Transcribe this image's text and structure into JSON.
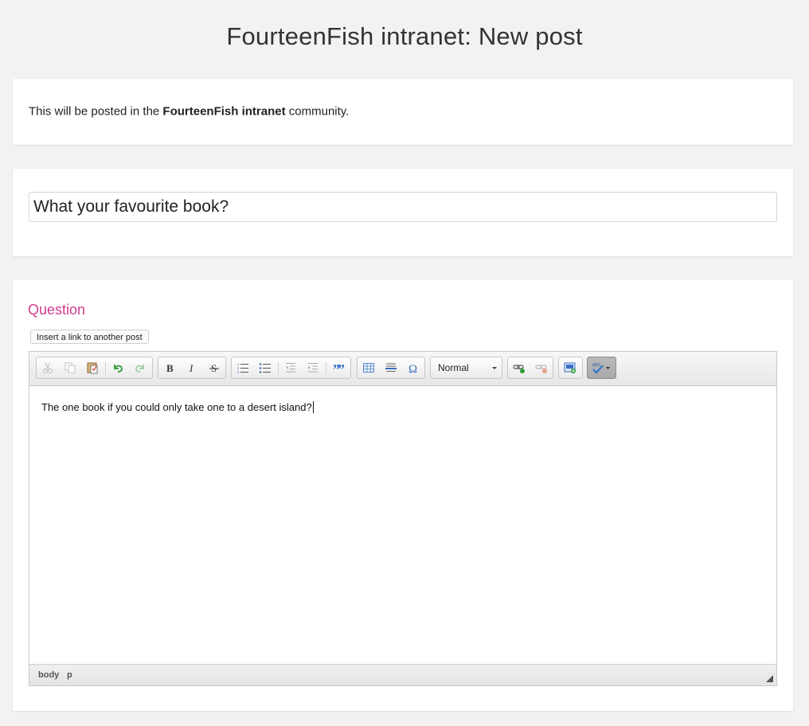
{
  "page": {
    "title": "FourteenFish intranet: New post"
  },
  "info_card": {
    "text_before": "This will be posted in the ",
    "community_name": "FourteenFish intranet",
    "text_after": " community."
  },
  "title_card": {
    "title_value": "What your favourite book?"
  },
  "editor_card": {
    "heading": "Question",
    "insert_link_label": "Insert a link to another post",
    "toolbar": {
      "buttons": [
        "cut-icon",
        "copy-icon",
        "paste-icon",
        "undo-icon",
        "redo-icon",
        "bold-icon",
        "italic-icon",
        "strikethrough-icon",
        "numbered-list-icon",
        "bulleted-list-icon",
        "decrease-indent-icon",
        "increase-indent-icon",
        "blockquote-icon",
        "table-icon",
        "horizontal-rule-icon",
        "special-character-icon",
        "link-icon",
        "unlink-icon",
        "image-icon",
        "spellcheck-icon"
      ],
      "format_value": "Normal"
    },
    "body_text": "The one book if you could only take one to a desert island?",
    "status_path": [
      "body",
      "p"
    ]
  }
}
